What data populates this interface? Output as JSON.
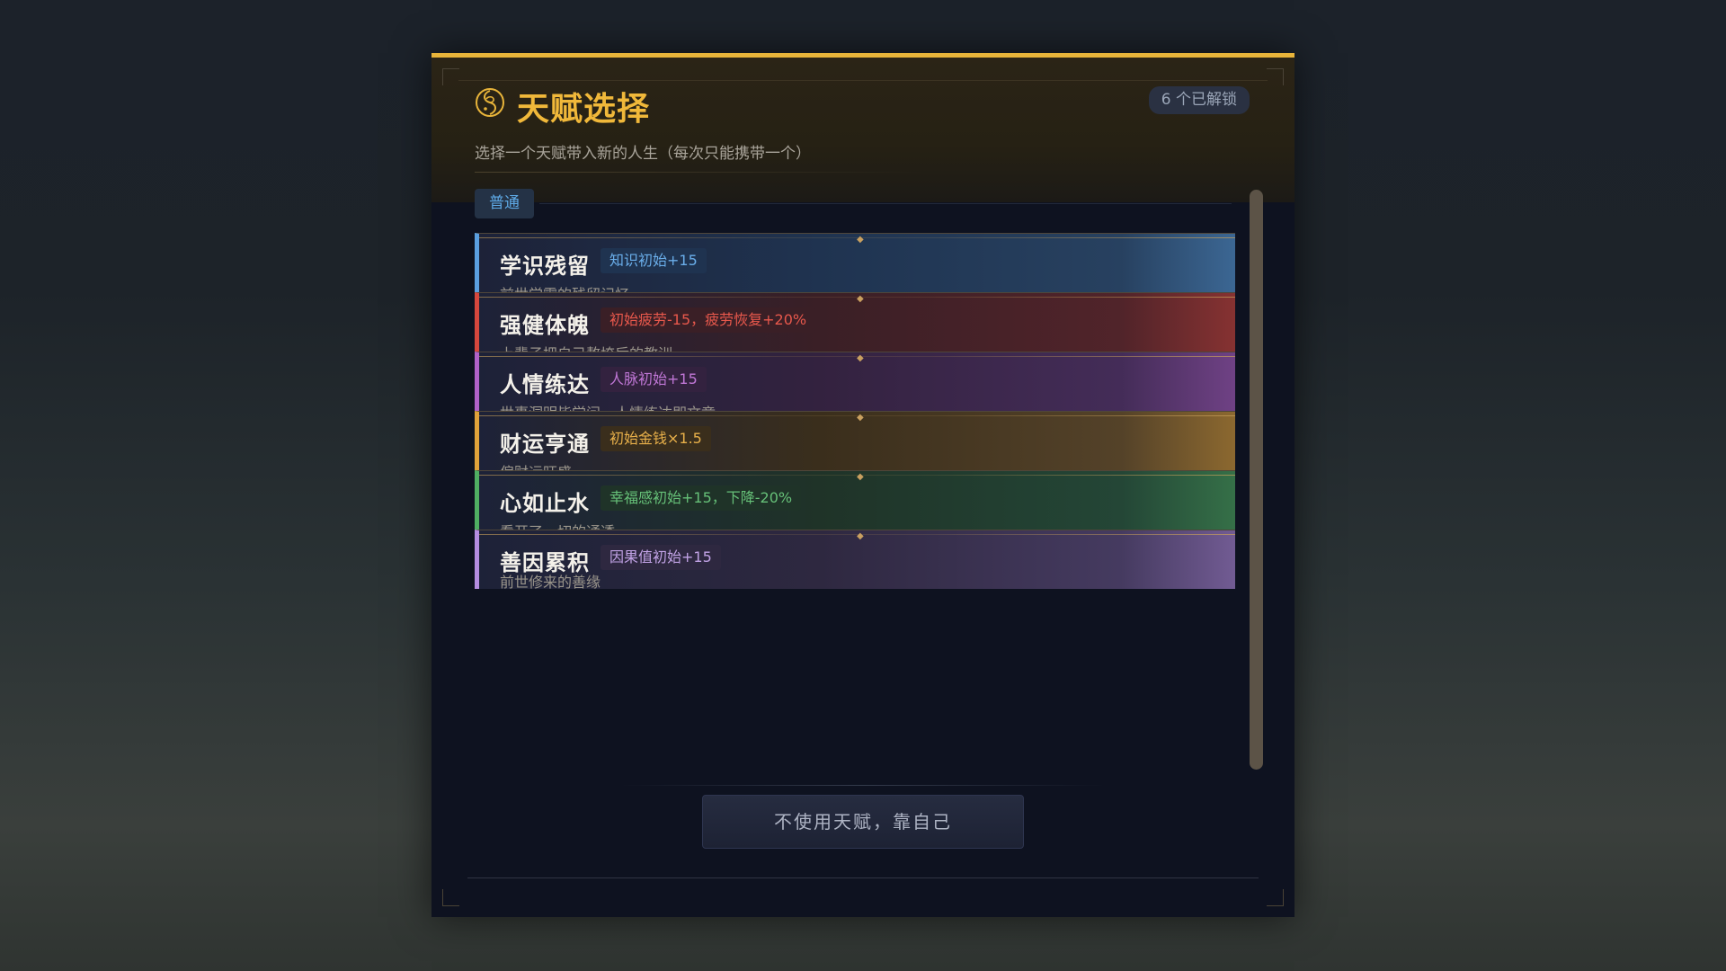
{
  "header": {
    "title": "天赋选择",
    "subtitle": "选择一个天赋带入新的人生（每次只能携带一个）",
    "unlocked_badge": "6 个已解锁"
  },
  "tier": {
    "label": "普通"
  },
  "talents": [
    {
      "name": "学识残留",
      "effect": "知识初始+15",
      "desc": "前世学霸的残留记忆",
      "color": "#5a9fe0",
      "effect_color": "#6aaeea",
      "effect_bg": "#1f3350"
    },
    {
      "name": "强健体魄",
      "effect": "初始疲劳-15，疲劳恢复+20%",
      "desc": "上辈子把自己熬垮后的教训",
      "color": "#d6473d",
      "effect_color": "#e8584c",
      "effect_bg": "#3a1f26"
    },
    {
      "name": "人情练达",
      "effect": "人脉初始+15",
      "desc": "世事洞明皆学问，人情练达即文章",
      "color": "#b061c8",
      "effect_color": "#c077d6",
      "effect_bg": "#33223f"
    },
    {
      "name": "财运亨通",
      "effect": "初始金钱×1.5",
      "desc": "偏财运旺盛",
      "color": "#e0a23a",
      "effect_color": "#e8b04a",
      "effect_bg": "#3a2e1c"
    },
    {
      "name": "心如止水",
      "effect": "幸福感初始+15，下降-20%",
      "desc": "看开了一切的通透",
      "color": "#4fae62",
      "effect_color": "#66c078",
      "effect_bg": "#1f3328"
    },
    {
      "name": "善因累积",
      "effect": "因果值初始+15",
      "desc": "前世修来的善缘",
      "color": "#b48ce0",
      "effect_color": "#c2a3e6",
      "effect_bg": "#2e2840"
    }
  ],
  "actions": {
    "no_talent_label": "不使用天赋，靠自己"
  },
  "colors": {
    "accent": "#e8b43a",
    "panel_bg": "#0e1220"
  },
  "icons": {
    "title_icon": "fortune-swirl-icon"
  }
}
